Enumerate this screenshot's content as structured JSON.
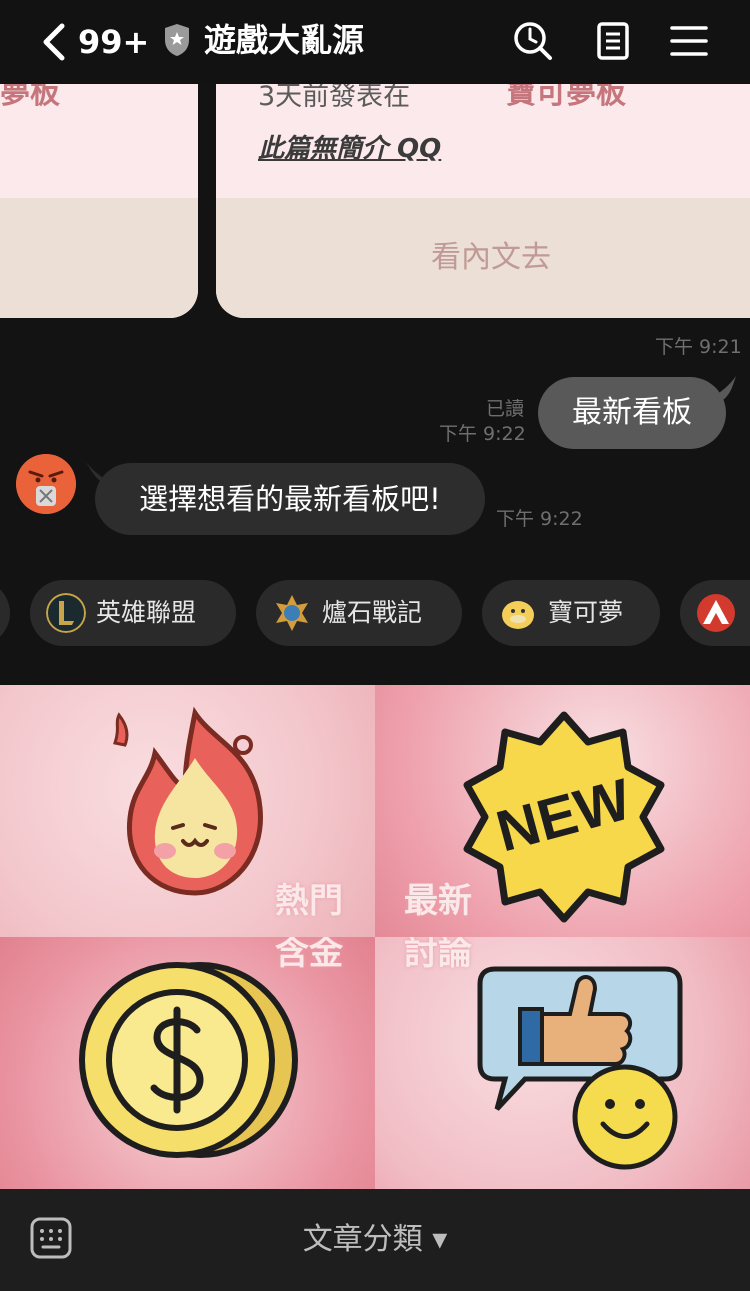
{
  "header": {
    "badge_count": "99+",
    "title": "遊戲大亂源"
  },
  "cards": {
    "left_board": "夢板",
    "posted_prefix": "3天前發表在",
    "board": "寶可夢板",
    "no_intro": "此篇無簡介 QQ",
    "read_button": "看內文去",
    "time": "下午 9:21"
  },
  "messages": {
    "outgoing": {
      "text": "最新看板",
      "read_label": "已讀",
      "time": "下午 9:22"
    },
    "incoming": {
      "text": "選擇想看的最新看板吧!",
      "time": "下午 9:22"
    }
  },
  "quick_replies": [
    {
      "label": "英雄聯盟",
      "icon": "league-of-legends-icon"
    },
    {
      "label": "爐石戰記",
      "icon": "hearthstone-icon"
    },
    {
      "label": "寶可夢",
      "icon": "psyduck-icon"
    },
    {
      "label": "",
      "icon": "apex-icon"
    }
  ],
  "menu_tiles": [
    {
      "line1": "熱門",
      "line2": "含金",
      "icon": "fire-icon"
    },
    {
      "line1": "最新",
      "line2": "討論",
      "icon": "new-badge-icon",
      "badge_text": "NEW"
    },
    {
      "icon": "coin-icon"
    },
    {
      "icon": "thumbs-up-icon"
    }
  ],
  "bottom_bar": {
    "label": "文章分類 ▾"
  },
  "colors": {
    "accent": "#c5767c",
    "background": "#131313"
  }
}
